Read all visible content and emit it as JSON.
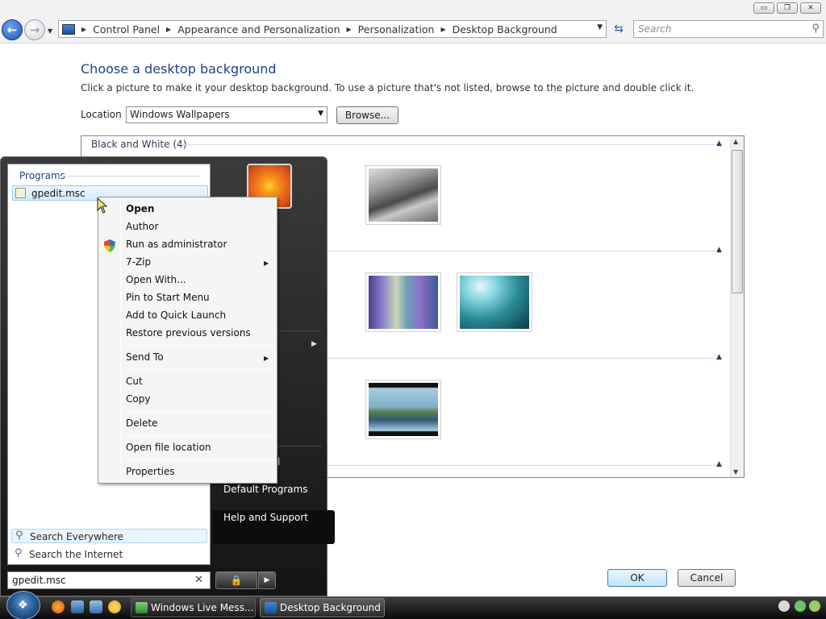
{
  "window": {
    "controls": {
      "minimize": "▭",
      "maximize": "❐",
      "close": "✕"
    },
    "breadcrumb": [
      "Control Panel",
      "Appearance and Personalization",
      "Personalization",
      "Desktop Background"
    ],
    "search_placeholder": "Search"
  },
  "content": {
    "title": "Choose a desktop background",
    "subtitle": "Click a picture to make it your desktop background. To use a picture that's not listed, browse to the picture and double click it.",
    "location_label": "Location",
    "location_value": "Windows Wallpapers",
    "browse_label": "Browse...",
    "gallery": {
      "group_1": "Black and White (4)"
    },
    "ok_label": "OK",
    "cancel_label": "Cancel"
  },
  "start_menu": {
    "programs_label": "Programs",
    "program_item": "gpedit.msc",
    "search_everywhere": "Search Everywhere",
    "search_internet": "Search the Internet",
    "search_value": "gpedit.msc",
    "right_items": {
      "partial": "l",
      "default_programs": "Default Programs",
      "help_support": "Help and Support"
    }
  },
  "context_menu": {
    "items": {
      "open": "Open",
      "author": "Author",
      "run_admin": "Run as administrator",
      "zip": "7-Zip",
      "open_with": "Open With...",
      "pin_start": "Pin to Start Menu",
      "add_quick": "Add to Quick Launch",
      "restore": "Restore previous versions",
      "send_to": "Send To",
      "cut": "Cut",
      "copy": "Copy",
      "delete": "Delete",
      "open_location": "Open file location",
      "properties": "Properties"
    }
  },
  "taskbar": {
    "buttons": {
      "messenger": "Windows Live Mess...",
      "desktop_bg": "Desktop Background"
    }
  },
  "colors": {
    "title_blue": "#1e3f8a",
    "selection_blue": "#d6ecfc",
    "start_menu_dark": "#141414"
  }
}
